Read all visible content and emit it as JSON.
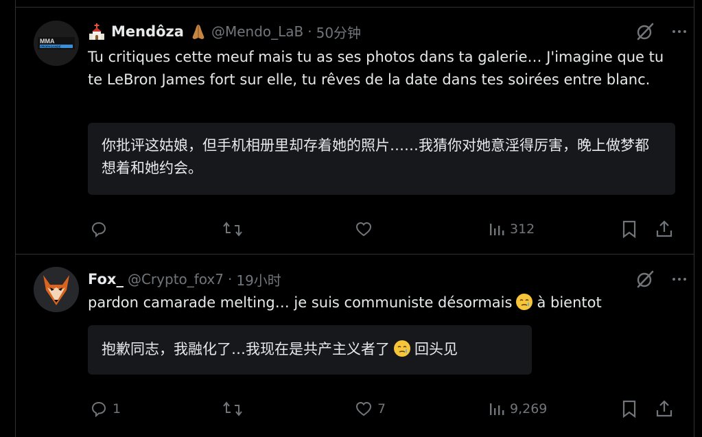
{
  "tweets": [
    {
      "name": "Mendôza",
      "handle": "@Mendo_LaB",
      "time": "50分钟",
      "avatar_text": "MMA",
      "avatar_subtext": "PROPAGANDE",
      "text": "Tu critiques cette meuf mais tu as ses photos dans ta galerie… J'imagine que tu te LeBron James fort sur elle, tu rêves de la date dans tes soirées entre blanc.",
      "translation": "你批评这姑娘，但手机相册里却存着她的照片……我猜你对她意淫得厉害，晚上做梦都想着和她约会。",
      "reply_count": "",
      "retweet_count": "",
      "like_count": "",
      "view_count": "312"
    },
    {
      "name": "Fox_",
      "handle": "@Crypto_fox7",
      "time": "19小时",
      "text_before": "pardon camarade melting… je suis communiste désormais",
      "text_after": "à bientot",
      "translation_before": "抱歉同志，我融化了…我现在是共产主义者了",
      "translation_after": "回头见",
      "reply_count": "1",
      "retweet_count": "",
      "like_count": "7",
      "view_count": "9,269"
    }
  ],
  "icons": {
    "header_left_emoji": "church-emoji",
    "header_right_emoji": "folded-hands-emoji",
    "text_emoji": "face-holding-back-tears-emoji",
    "grok": "grok-icon",
    "more": "more-icon",
    "reply": "reply-icon",
    "retweet": "retweet-icon",
    "like": "like-icon",
    "views": "views-icon",
    "bookmark": "bookmark-icon",
    "share": "share-icon"
  },
  "colors": {
    "background": "#000000",
    "text": "#e7e9ea",
    "muted": "#71767b",
    "divider": "#2f3336",
    "translation_bg": "#16181c"
  }
}
